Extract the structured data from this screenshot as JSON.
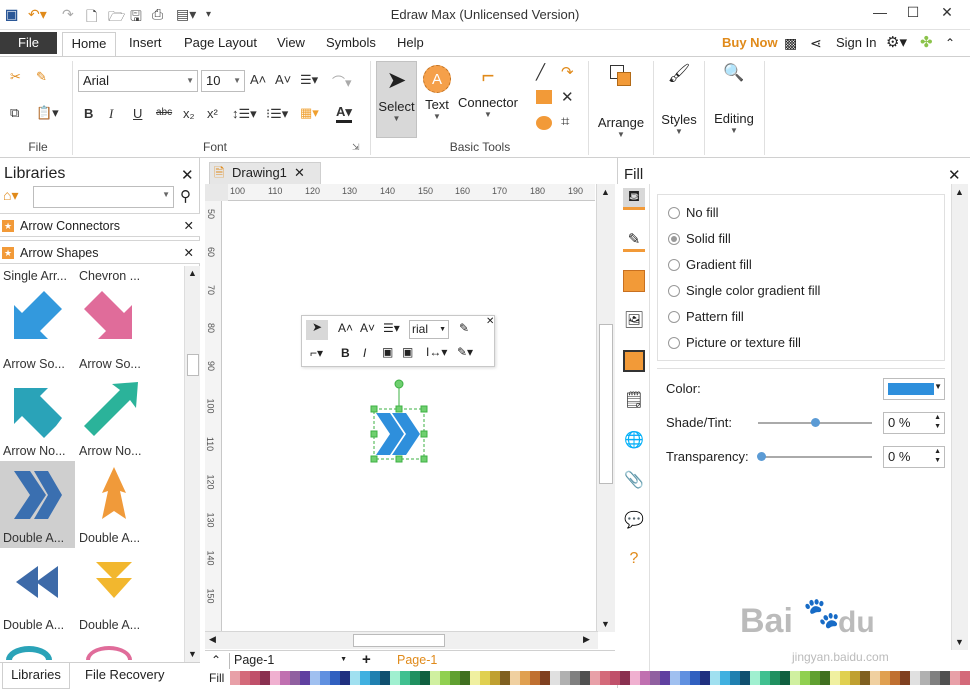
{
  "app": {
    "title": "Edraw Max (Unlicensed Version)"
  },
  "menu": {
    "file": "File",
    "tabs": [
      "Home",
      "Insert",
      "Page Layout",
      "View",
      "Symbols",
      "Help"
    ],
    "buy_now": "Buy Now",
    "sign_in": "Sign In"
  },
  "ribbon": {
    "groups": {
      "file": "File",
      "font": "Font",
      "basic_tools": "Basic Tools"
    },
    "font_name": "Arial",
    "font_size": "10",
    "tools": {
      "select": "Select",
      "text": "Text",
      "connector": "Connector"
    },
    "arrange": "Arrange",
    "styles": "Styles",
    "editing": "Editing"
  },
  "libraries": {
    "title": "Libraries",
    "rows": [
      "Arrow Connectors",
      "Arrow Shapes"
    ],
    "shapes": [
      {
        "label": "Single Arr...",
        "color": "#333"
      },
      {
        "label": "Chevron ...",
        "color": "#333"
      },
      {
        "label": "Arrow So...",
        "color": "#3399dd"
      },
      {
        "label": "Arrow So...",
        "color": "#e06c9a"
      },
      {
        "label": "Arrow No...",
        "color": "#2aa3b8"
      },
      {
        "label": "Arrow No...",
        "color": "#2bb39a"
      },
      {
        "label": "Double A...",
        "color": "#3a6fb0"
      },
      {
        "label": "Double A...",
        "color": "#f09a3a"
      },
      {
        "label": "Double A...",
        "color": "#3d6aa8"
      },
      {
        "label": "Double A...",
        "color": "#f2b72e"
      }
    ],
    "bottom_tabs": [
      "Libraries",
      "File Recovery"
    ]
  },
  "document": {
    "tab": "Drawing1",
    "ruler_top": [
      "100",
      "110",
      "120",
      "130",
      "140",
      "150",
      "160",
      "170",
      "180",
      "190"
    ],
    "ruler_left": [
      "50",
      "60",
      "70",
      "80",
      "90",
      "100",
      "110",
      "120",
      "130",
      "140",
      "150"
    ],
    "floating_font": "rial"
  },
  "fill_panel": {
    "title": "Fill",
    "options": [
      "No fill",
      "Solid fill",
      "Gradient fill",
      "Single color gradient fill",
      "Pattern fill",
      "Picture or texture fill"
    ],
    "selected": "Solid fill",
    "color_label": "Color:",
    "color_value": "#2e8fdc",
    "shade_label": "Shade/Tint:",
    "shade_value": "0 %",
    "shade_position": 0.5,
    "transparency_label": "Transparency:",
    "transparency_value": "0 %",
    "transparency_position": 0.0
  },
  "status": {
    "page_select": "Page-1",
    "page_tab": "Page-1",
    "fill_label": "Fill"
  }
}
